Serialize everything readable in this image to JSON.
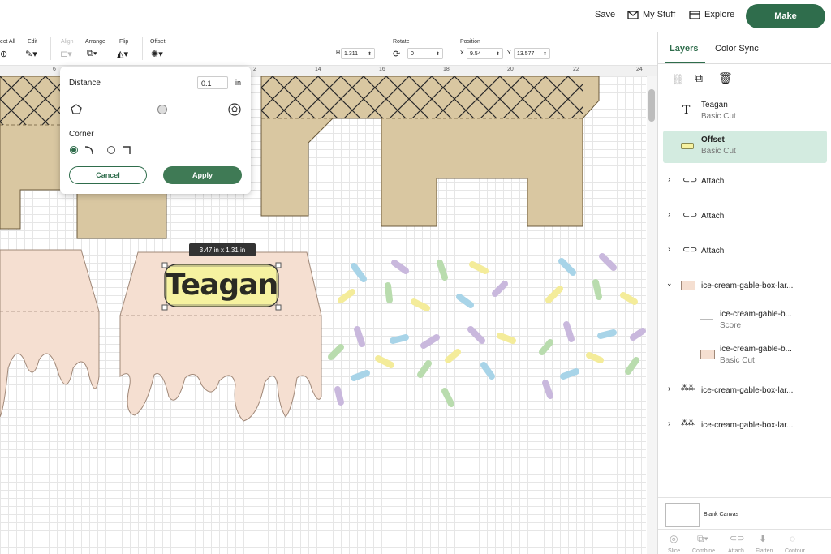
{
  "header": {
    "save": "Save",
    "my_stuff": "My Stuff",
    "explore": "Explore",
    "make": "Make"
  },
  "toolbar": {
    "select_all": "ect All",
    "edit": "Edit",
    "align": "Align",
    "arrange": "Arrange",
    "flip": "Flip",
    "offset": "Offset",
    "height_label": "H",
    "height_value": "1.311",
    "rotate": "Rotate",
    "rotate_value": "0",
    "position": "Position",
    "x_label": "X",
    "x_value": "9.54",
    "y_label": "Y",
    "y_value": "13.577"
  },
  "ruler": {
    "ticks": [
      "6",
      "2",
      "14",
      "16",
      "18",
      "20",
      "22",
      "24"
    ]
  },
  "offset_popover": {
    "distance_label": "Distance",
    "distance_value": "0.1",
    "unit": "in",
    "corner_label": "Corner",
    "cancel": "Cancel",
    "apply": "Apply"
  },
  "canvas": {
    "selection_text": "Teagan",
    "dimension_tooltip": "3.47  in x 1.31  in"
  },
  "layers_panel": {
    "tabs": [
      "Layers",
      "Color Sync"
    ],
    "active_tab": "Layers",
    "items": [
      {
        "name": "Teagan",
        "sub": "Basic Cut",
        "icon": "text-icon"
      },
      {
        "name": "Offset",
        "sub": "Basic Cut",
        "icon": "offset-shape-icon",
        "selected": true
      },
      {
        "name": "Attach",
        "icon": "attach-icon"
      },
      {
        "name": "Attach",
        "icon": "attach-icon"
      },
      {
        "name": "Attach",
        "icon": "attach-icon"
      },
      {
        "name": "ice-cream-gable-box-lar...",
        "icon": "group-thumbnail-icon"
      },
      {
        "name": "ice-cream-gable-b...",
        "sub": "Score",
        "icon": "score-line-icon"
      },
      {
        "name": "ice-cream-gable-b...",
        "sub": "Basic Cut",
        "icon": "drip-thumbnail-icon"
      },
      {
        "name": "ice-cream-gable-box-lar...",
        "icon": "sprinkles-thumbnail-icon"
      },
      {
        "name": "ice-cream-gable-box-lar...",
        "icon": "sprinkles-thumbnail-icon"
      }
    ],
    "blank_canvas": "Blank Canvas",
    "bottom_actions": [
      "Slice",
      "Combine",
      "Attach",
      "Flatten",
      "Contour"
    ]
  },
  "colors": {
    "brand_green": "#2f6d4c",
    "selected_layer_bg": "#d3ebe0",
    "cone_tan": "#d9c7a1",
    "icing_pink": "#f5dfd1",
    "arrow_red": "#e8161b"
  }
}
